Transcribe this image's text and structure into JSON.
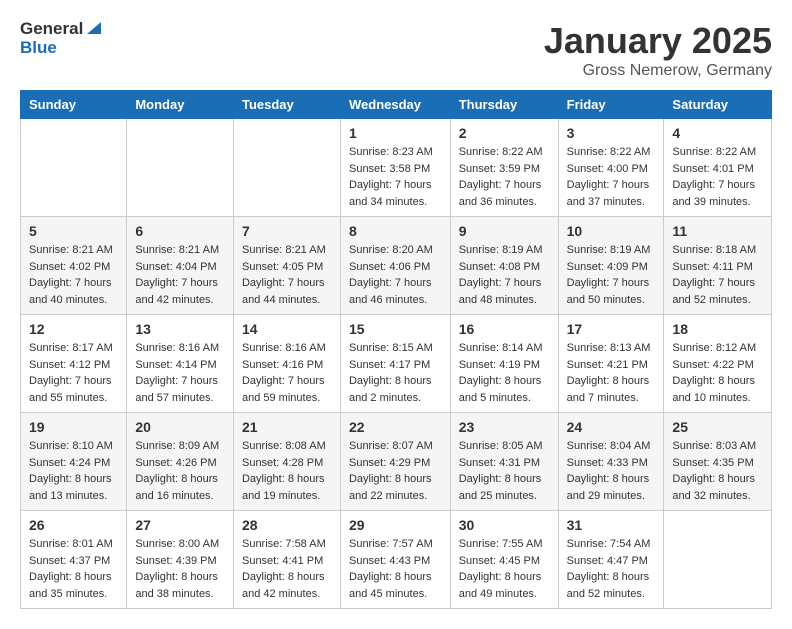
{
  "header": {
    "logo_general": "General",
    "logo_blue": "Blue",
    "month": "January 2025",
    "location": "Gross Nemerow, Germany"
  },
  "days_of_week": [
    "Sunday",
    "Monday",
    "Tuesday",
    "Wednesday",
    "Thursday",
    "Friday",
    "Saturday"
  ],
  "weeks": [
    [
      {
        "day": "",
        "sunrise": "",
        "sunset": "",
        "daylight": ""
      },
      {
        "day": "",
        "sunrise": "",
        "sunset": "",
        "daylight": ""
      },
      {
        "day": "",
        "sunrise": "",
        "sunset": "",
        "daylight": ""
      },
      {
        "day": "1",
        "sunrise": "Sunrise: 8:23 AM",
        "sunset": "Sunset: 3:58 PM",
        "daylight": "Daylight: 7 hours and 34 minutes."
      },
      {
        "day": "2",
        "sunrise": "Sunrise: 8:22 AM",
        "sunset": "Sunset: 3:59 PM",
        "daylight": "Daylight: 7 hours and 36 minutes."
      },
      {
        "day": "3",
        "sunrise": "Sunrise: 8:22 AM",
        "sunset": "Sunset: 4:00 PM",
        "daylight": "Daylight: 7 hours and 37 minutes."
      },
      {
        "day": "4",
        "sunrise": "Sunrise: 8:22 AM",
        "sunset": "Sunset: 4:01 PM",
        "daylight": "Daylight: 7 hours and 39 minutes."
      }
    ],
    [
      {
        "day": "5",
        "sunrise": "Sunrise: 8:21 AM",
        "sunset": "Sunset: 4:02 PM",
        "daylight": "Daylight: 7 hours and 40 minutes."
      },
      {
        "day": "6",
        "sunrise": "Sunrise: 8:21 AM",
        "sunset": "Sunset: 4:04 PM",
        "daylight": "Daylight: 7 hours and 42 minutes."
      },
      {
        "day": "7",
        "sunrise": "Sunrise: 8:21 AM",
        "sunset": "Sunset: 4:05 PM",
        "daylight": "Daylight: 7 hours and 44 minutes."
      },
      {
        "day": "8",
        "sunrise": "Sunrise: 8:20 AM",
        "sunset": "Sunset: 4:06 PM",
        "daylight": "Daylight: 7 hours and 46 minutes."
      },
      {
        "day": "9",
        "sunrise": "Sunrise: 8:19 AM",
        "sunset": "Sunset: 4:08 PM",
        "daylight": "Daylight: 7 hours and 48 minutes."
      },
      {
        "day": "10",
        "sunrise": "Sunrise: 8:19 AM",
        "sunset": "Sunset: 4:09 PM",
        "daylight": "Daylight: 7 hours and 50 minutes."
      },
      {
        "day": "11",
        "sunrise": "Sunrise: 8:18 AM",
        "sunset": "Sunset: 4:11 PM",
        "daylight": "Daylight: 7 hours and 52 minutes."
      }
    ],
    [
      {
        "day": "12",
        "sunrise": "Sunrise: 8:17 AM",
        "sunset": "Sunset: 4:12 PM",
        "daylight": "Daylight: 7 hours and 55 minutes."
      },
      {
        "day": "13",
        "sunrise": "Sunrise: 8:16 AM",
        "sunset": "Sunset: 4:14 PM",
        "daylight": "Daylight: 7 hours and 57 minutes."
      },
      {
        "day": "14",
        "sunrise": "Sunrise: 8:16 AM",
        "sunset": "Sunset: 4:16 PM",
        "daylight": "Daylight: 7 hours and 59 minutes."
      },
      {
        "day": "15",
        "sunrise": "Sunrise: 8:15 AM",
        "sunset": "Sunset: 4:17 PM",
        "daylight": "Daylight: 8 hours and 2 minutes."
      },
      {
        "day": "16",
        "sunrise": "Sunrise: 8:14 AM",
        "sunset": "Sunset: 4:19 PM",
        "daylight": "Daylight: 8 hours and 5 minutes."
      },
      {
        "day": "17",
        "sunrise": "Sunrise: 8:13 AM",
        "sunset": "Sunset: 4:21 PM",
        "daylight": "Daylight: 8 hours and 7 minutes."
      },
      {
        "day": "18",
        "sunrise": "Sunrise: 8:12 AM",
        "sunset": "Sunset: 4:22 PM",
        "daylight": "Daylight: 8 hours and 10 minutes."
      }
    ],
    [
      {
        "day": "19",
        "sunrise": "Sunrise: 8:10 AM",
        "sunset": "Sunset: 4:24 PM",
        "daylight": "Daylight: 8 hours and 13 minutes."
      },
      {
        "day": "20",
        "sunrise": "Sunrise: 8:09 AM",
        "sunset": "Sunset: 4:26 PM",
        "daylight": "Daylight: 8 hours and 16 minutes."
      },
      {
        "day": "21",
        "sunrise": "Sunrise: 8:08 AM",
        "sunset": "Sunset: 4:28 PM",
        "daylight": "Daylight: 8 hours and 19 minutes."
      },
      {
        "day": "22",
        "sunrise": "Sunrise: 8:07 AM",
        "sunset": "Sunset: 4:29 PM",
        "daylight": "Daylight: 8 hours and 22 minutes."
      },
      {
        "day": "23",
        "sunrise": "Sunrise: 8:05 AM",
        "sunset": "Sunset: 4:31 PM",
        "daylight": "Daylight: 8 hours and 25 minutes."
      },
      {
        "day": "24",
        "sunrise": "Sunrise: 8:04 AM",
        "sunset": "Sunset: 4:33 PM",
        "daylight": "Daylight: 8 hours and 29 minutes."
      },
      {
        "day": "25",
        "sunrise": "Sunrise: 8:03 AM",
        "sunset": "Sunset: 4:35 PM",
        "daylight": "Daylight: 8 hours and 32 minutes."
      }
    ],
    [
      {
        "day": "26",
        "sunrise": "Sunrise: 8:01 AM",
        "sunset": "Sunset: 4:37 PM",
        "daylight": "Daylight: 8 hours and 35 minutes."
      },
      {
        "day": "27",
        "sunrise": "Sunrise: 8:00 AM",
        "sunset": "Sunset: 4:39 PM",
        "daylight": "Daylight: 8 hours and 38 minutes."
      },
      {
        "day": "28",
        "sunrise": "Sunrise: 7:58 AM",
        "sunset": "Sunset: 4:41 PM",
        "daylight": "Daylight: 8 hours and 42 minutes."
      },
      {
        "day": "29",
        "sunrise": "Sunrise: 7:57 AM",
        "sunset": "Sunset: 4:43 PM",
        "daylight": "Daylight: 8 hours and 45 minutes."
      },
      {
        "day": "30",
        "sunrise": "Sunrise: 7:55 AM",
        "sunset": "Sunset: 4:45 PM",
        "daylight": "Daylight: 8 hours and 49 minutes."
      },
      {
        "day": "31",
        "sunrise": "Sunrise: 7:54 AM",
        "sunset": "Sunset: 4:47 PM",
        "daylight": "Daylight: 8 hours and 52 minutes."
      },
      {
        "day": "",
        "sunrise": "",
        "sunset": "",
        "daylight": ""
      }
    ]
  ]
}
